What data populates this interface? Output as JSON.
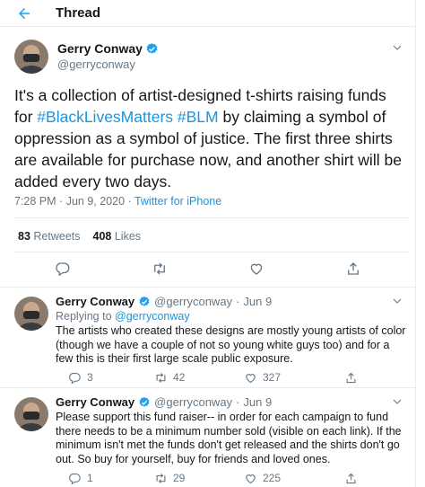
{
  "header": {
    "title": "Thread",
    "back_icon": "arrow-left-icon"
  },
  "colors": {
    "accent": "#1da1f2",
    "link": "#1b95e0",
    "text": "#14171a",
    "muted": "#657786",
    "divider": "#e6ecf0"
  },
  "main_tweet": {
    "author_name": "Gerry Conway",
    "verified": true,
    "handle": "@gerryconway",
    "text_segments": [
      {
        "text": "It's a collection of artist-designed t-shirts raising funds for "
      },
      {
        "text": "#BlackLivesMatters",
        "hashtag": true
      },
      {
        "text": " "
      },
      {
        "text": "#BLM",
        "hashtag": true
      },
      {
        "text": " by claiming a symbol of oppression as a symbol of justice. The first three shirts are available for purchase now, and another shirt will be added every two days."
      }
    ],
    "time": "7:28 PM",
    "date": "Jun 9, 2020",
    "source": "Twitter for iPhone",
    "retweets": "83",
    "retweets_label": "Retweets",
    "likes": "408",
    "likes_label": "Likes"
  },
  "replies": [
    {
      "author_name": "Gerry Conway",
      "handle": "@gerryconway",
      "date": "Jun 9",
      "replying_label": "Replying to",
      "replying_to": "@gerryconway",
      "text": "The artists who created these designs are mostly young artists of color (though we have a couple of not so young white guys too) and for a few this is their first large scale public exposure.",
      "reply_count": "3",
      "retweet_count": "42",
      "like_count": "327"
    },
    {
      "author_name": "Gerry Conway",
      "handle": "@gerryconway",
      "date": "Jun 9",
      "text": "Please support this fund raiser-- in order for each campaign to fund there needs to be a minimum number sold (visible on each link). If the minimum isn't met the funds don't get released and the shirts don't go out. So buy for yourself, buy for friends and loved ones.",
      "reply_count": "1",
      "retweet_count": "29",
      "like_count": "225"
    }
  ]
}
